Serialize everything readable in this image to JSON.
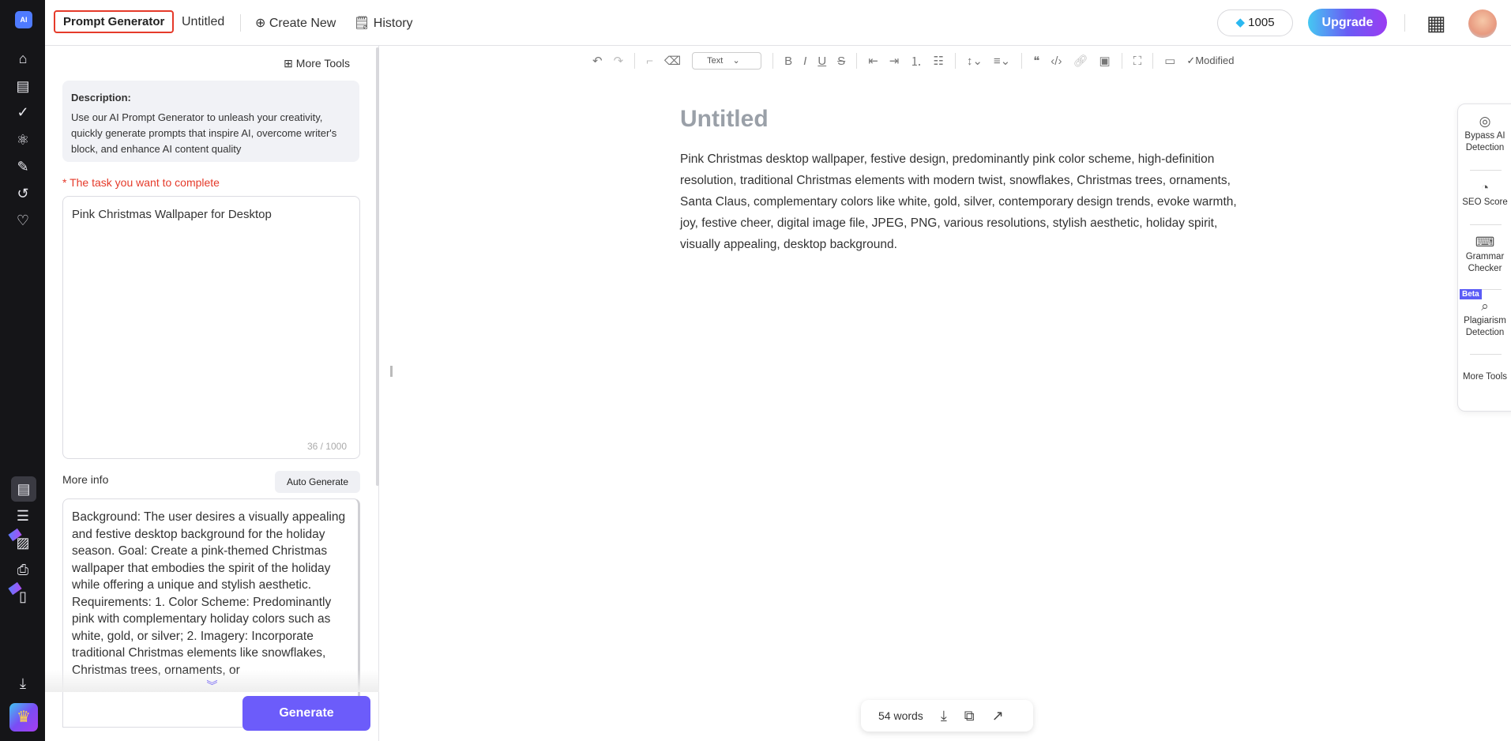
{
  "header": {
    "tool_name": "Prompt Generator",
    "doc_name": "Untitled",
    "create_new": "Create New",
    "history": "History",
    "credits": "1005",
    "upgrade": "Upgrade"
  },
  "rail": {
    "logo": "AI",
    "new_badge": "new"
  },
  "panel": {
    "more_tools": "More Tools",
    "description_title": "Description:",
    "description_text": "Use our AI Prompt Generator to unleash your creativity, quickly generate prompts that inspire AI, overcome writer's block, and enhance AI content quality",
    "task_required": "*",
    "task_label": "The task you want to complete",
    "task_value": "Pink Christmas Wallpaper for Desktop",
    "task_count": "36 / 1000",
    "more_info_label": "More info",
    "auto_generate": "Auto Generate",
    "more_info_value": "Background: The user desires a visually appealing and festive desktop background for the holiday season. Goal: Create a pink-themed Christmas wallpaper that embodies the spirit of the holiday while offering a unique and stylish aesthetic. Requirements: 1. Color Scheme: Predominantly pink with complementary holiday colors such as white, gold, or silver; 2. Imagery: Incorporate traditional Christmas elements like snowflakes, Christmas trees, ornaments, or",
    "generate": "Generate"
  },
  "toolbar": {
    "text_style": "Text",
    "status": "Modified"
  },
  "document": {
    "title": "Untitled",
    "body": "Pink Christmas desktop wallpaper, festive design, predominantly pink color scheme, high-definition resolution, traditional Christmas elements with modern twist, snowflakes, Christmas trees, ornaments, Santa Claus, complementary colors like white, gold, silver, contemporary design trends, evoke warmth, joy, festive cheer, digital image file, JPEG, PNG, various resolutions, stylish aesthetic, holiday spirit, visually appealing, desktop background."
  },
  "side_tools": [
    {
      "label": "Bypass AI Detection"
    },
    {
      "label": "SEO Score"
    },
    {
      "label": "Grammar Checker"
    },
    {
      "label": "Plagiarism Detection",
      "badge": "Beta"
    },
    {
      "label": "More Tools"
    }
  ],
  "footer": {
    "word_count": "54 words"
  },
  "colors": {
    "accent": "#6c5cfa",
    "highlight_border": "#e53a2a",
    "rail_bg": "#151518"
  }
}
